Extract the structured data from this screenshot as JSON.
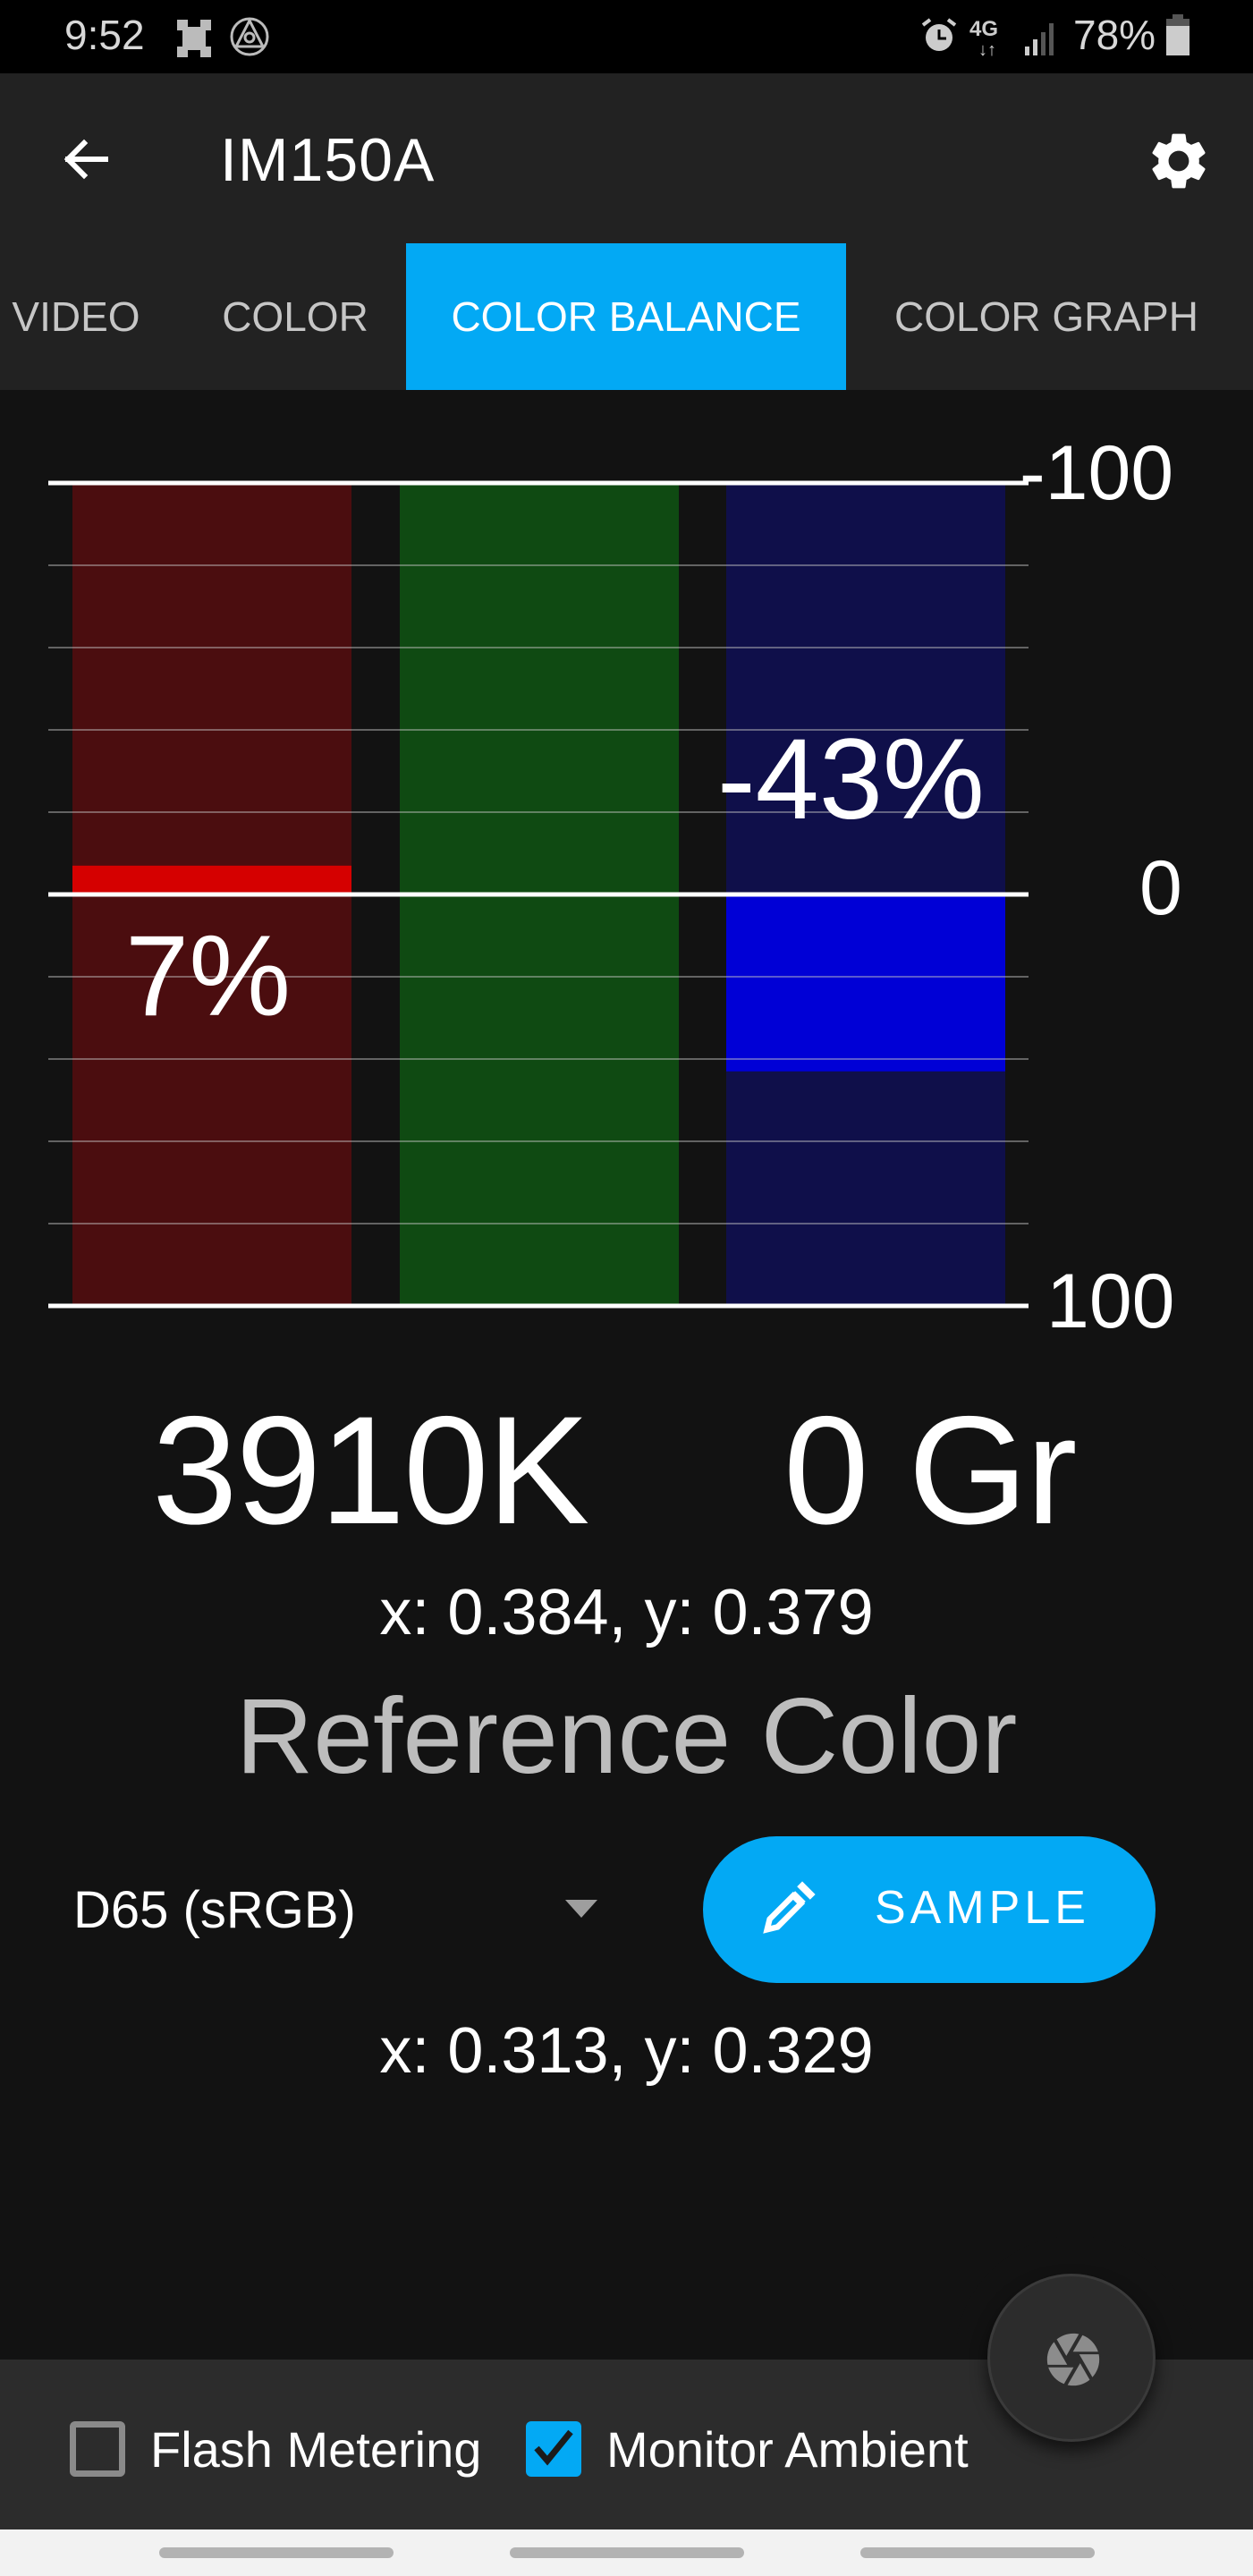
{
  "status_bar": {
    "time": "9:52",
    "battery": "78%",
    "icons": [
      "device-icon",
      "app-notification-icon",
      "alarm-icon",
      "4g-lte-icon",
      "signal-icon",
      "battery-icon"
    ]
  },
  "app_bar": {
    "title": "IM150A",
    "back_icon": "arrow-left-icon",
    "settings_icon": "gear-icon"
  },
  "tabs": [
    {
      "label": "VIDEO",
      "active": false
    },
    {
      "label": "COLOR",
      "active": false
    },
    {
      "label": "COLOR BALANCE",
      "active": true
    },
    {
      "label": "COLOR GRAPH",
      "active": false
    }
  ],
  "chart_data": {
    "type": "bar",
    "title": "",
    "xlabel": "",
    "ylabel": "",
    "orientation": "inverted",
    "ylim": [
      -100,
      100
    ],
    "yticks": [
      -100,
      0,
      100
    ],
    "ytick_labels": [
      "-100",
      "0",
      "100"
    ],
    "grid": true,
    "grid_step": 20,
    "categories": [
      "Red",
      "Green",
      "Blue"
    ],
    "values": [
      -7,
      0,
      43
    ],
    "value_labels": [
      "7%",
      "",
      "-43%"
    ],
    "colors": {
      "Red": {
        "track": "#4b0d0f",
        "fill": "#d50000"
      },
      "Green": {
        "track": "#0f4a12",
        "fill": "#1faa1f"
      },
      "Blue": {
        "track": "#0f0f4a",
        "fill": "#0000d6"
      }
    }
  },
  "readings": {
    "cct": "3910K",
    "tint": "0 Gr",
    "measured_xy": "x: 0.384, y: 0.379"
  },
  "reference": {
    "title": "Reference Color",
    "selected": "D65 (sRGB)",
    "sample_label": "SAMPLE",
    "reference_xy": "x: 0.313, y: 0.329"
  },
  "bottom": {
    "flash_metering": {
      "label": "Flash Metering",
      "checked": false
    },
    "monitor_ambient": {
      "label": "Monitor Ambient",
      "checked": true
    },
    "fab_icon": "camera-shutter-icon"
  },
  "colors": {
    "accent": "#03a9f4",
    "background": "#121212",
    "bar": "#222222"
  }
}
